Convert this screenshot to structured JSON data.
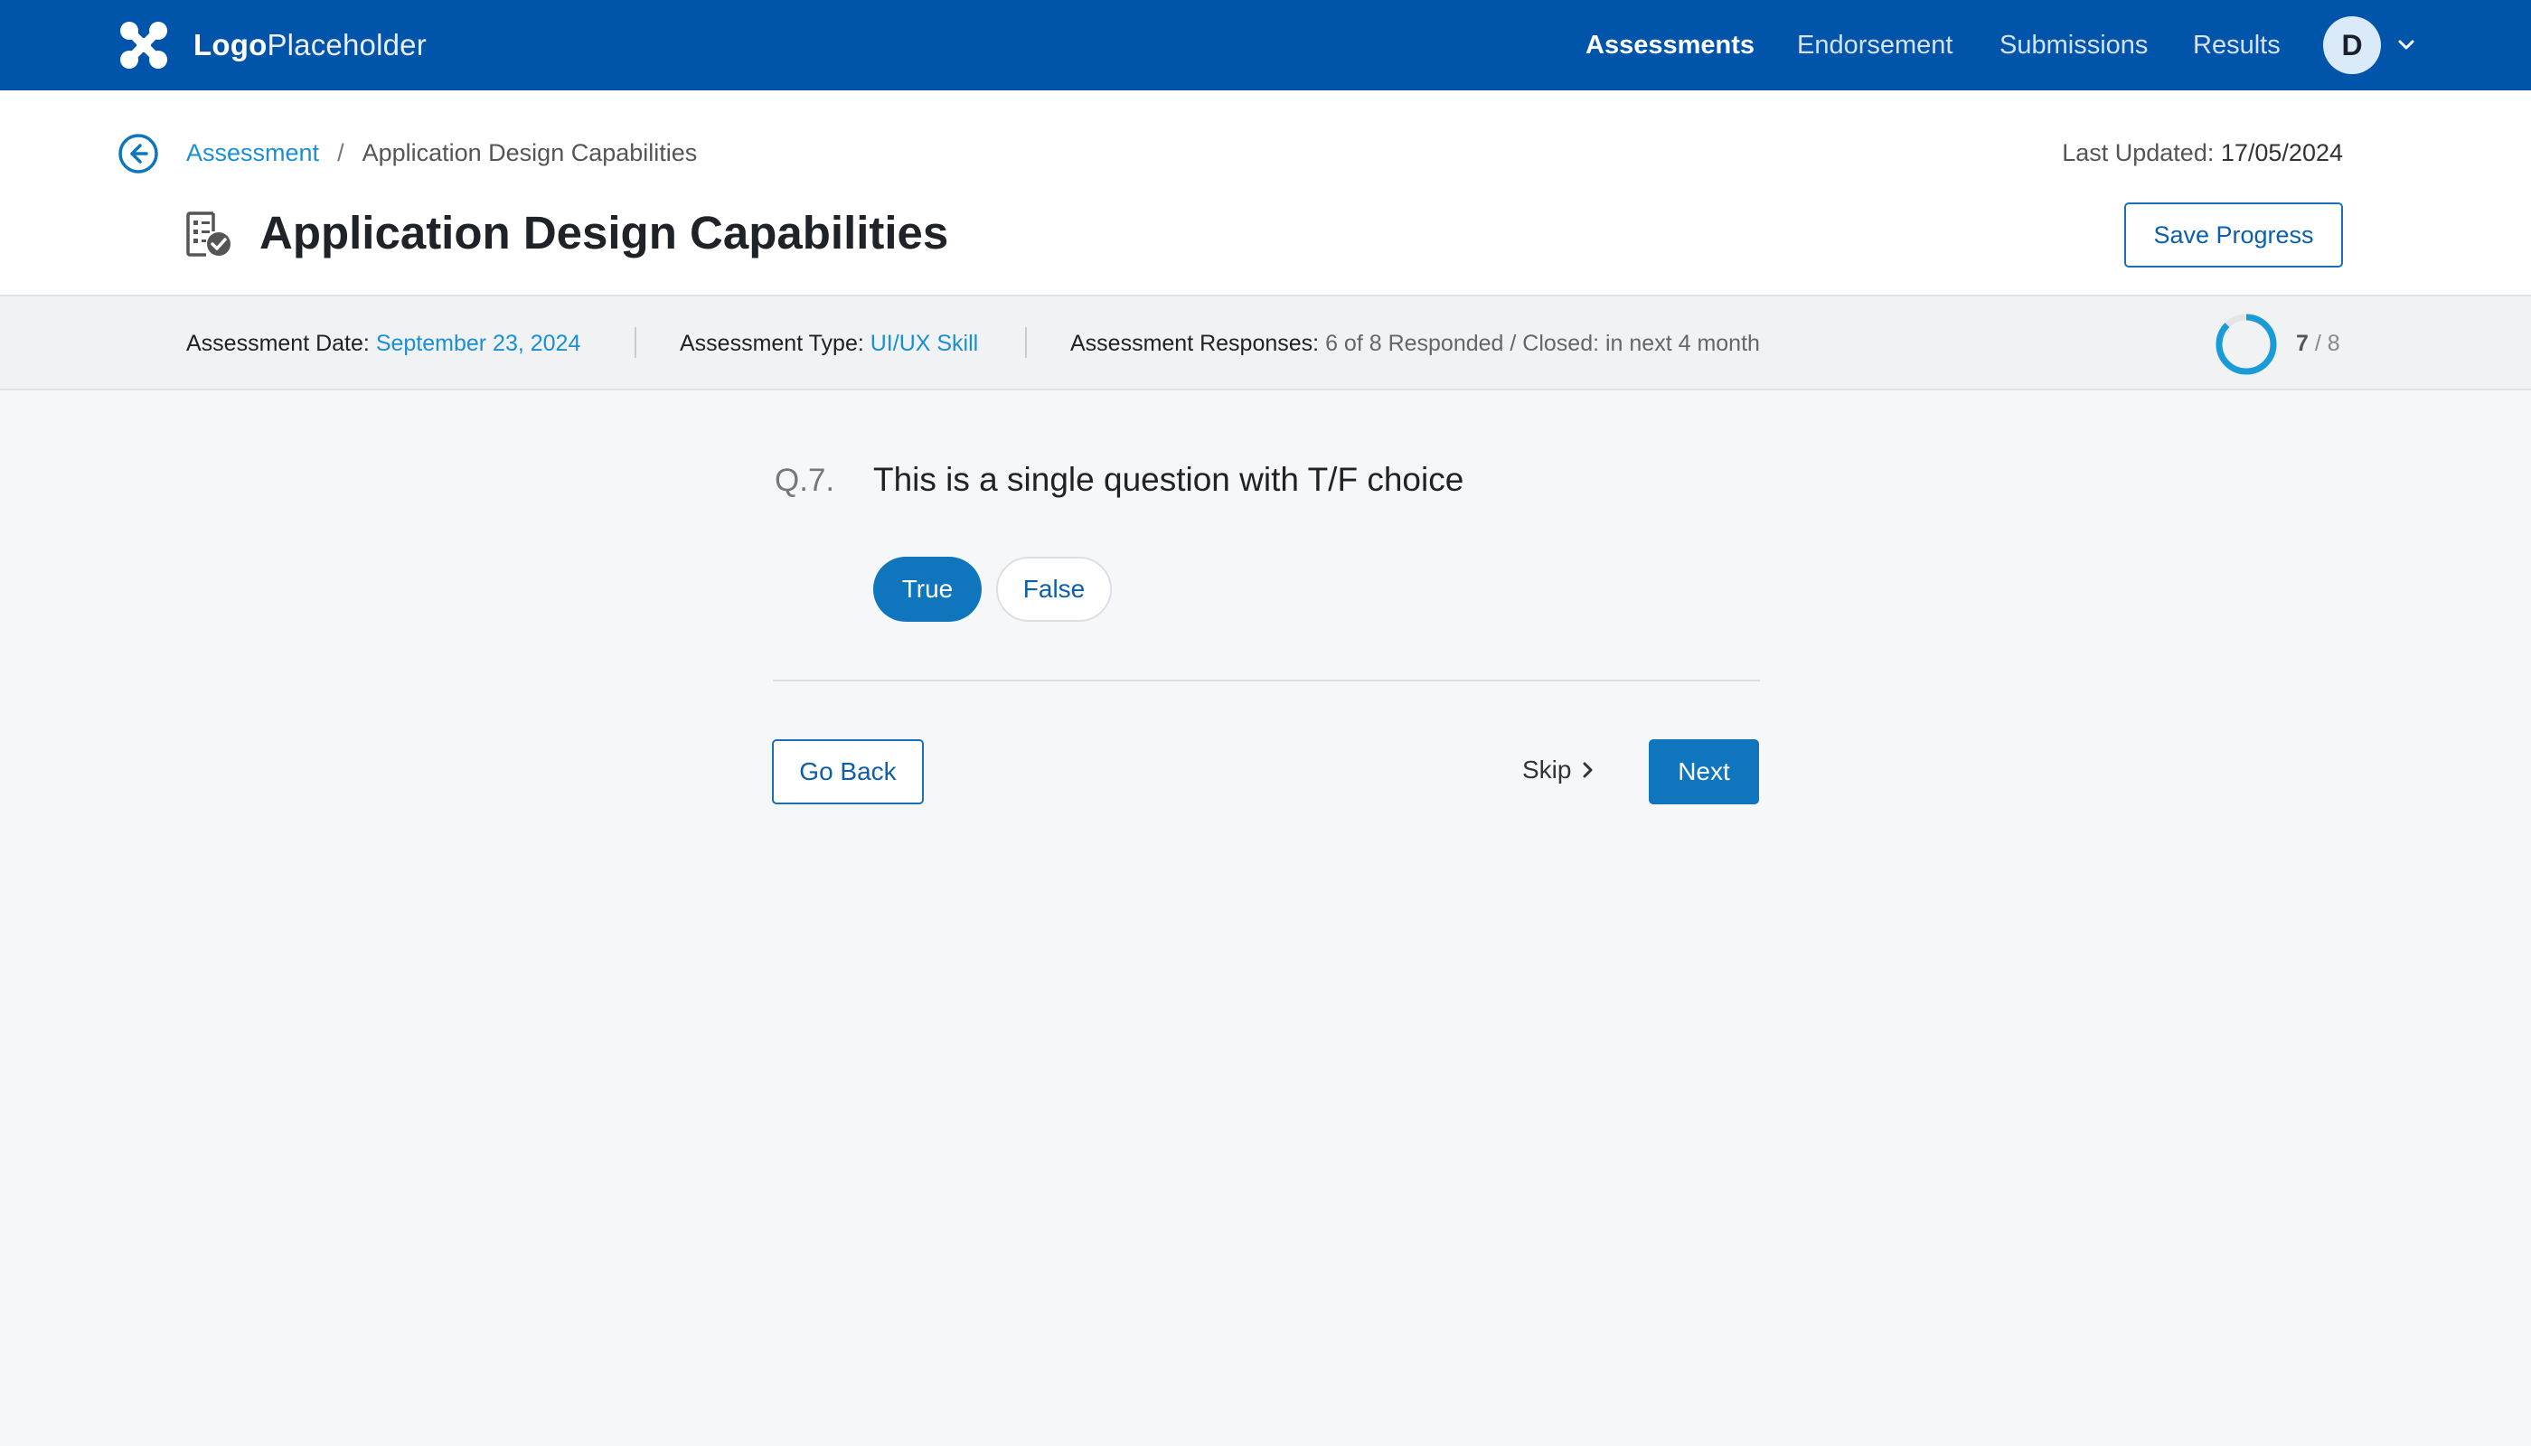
{
  "app": {
    "logo_bold": "Logo",
    "logo_light": "Placeholder"
  },
  "nav": {
    "items": [
      {
        "label": "Assessments",
        "active": true
      },
      {
        "label": "Endorsement",
        "active": false
      },
      {
        "label": "Submissions",
        "active": false
      },
      {
        "label": "Results",
        "active": false
      }
    ],
    "avatar_initial": "D"
  },
  "header": {
    "breadcrumb": {
      "parent": "Assessment",
      "separator": "/",
      "current": "Application Design Capabilities"
    },
    "last_updated_label": "Last Updated:",
    "last_updated_value": "17/05/2024",
    "title": "Application Design Capabilities",
    "save_label": "Save Progress"
  },
  "info": {
    "date_label": "Assessment Date:",
    "date_value": "September 23, 2024",
    "type_label": "Assessment Type:",
    "type_value": "UI/UX Skill",
    "responses_label": "Assessment Responses:",
    "responses_value": "6 of 8 Responded / Closed: in next 4 month",
    "progress_current": "7",
    "progress_separator": "/",
    "progress_total": "8"
  },
  "question": {
    "number": "Q.7.",
    "text": "This is a single question with T/F choice",
    "choices": [
      {
        "label": "True",
        "selected": true
      },
      {
        "label": "False",
        "selected": false
      }
    ]
  },
  "actions": {
    "go_back_label": "Go Back",
    "skip_label": "Skip",
    "next_label": "Next"
  },
  "colors": {
    "topbar": "#0055aa",
    "accent": "#0f76bd",
    "link": "#1a8fd6",
    "progress_ring": "#1a9bd9",
    "progress_track": "#e4e4e4"
  },
  "icons": {
    "logo": "logo-mark-icon",
    "back": "arrow-left-circle-icon",
    "title": "checklist-document-icon",
    "avatar_menu": "chevron-down-icon",
    "skip": "chevron-right-icon"
  }
}
